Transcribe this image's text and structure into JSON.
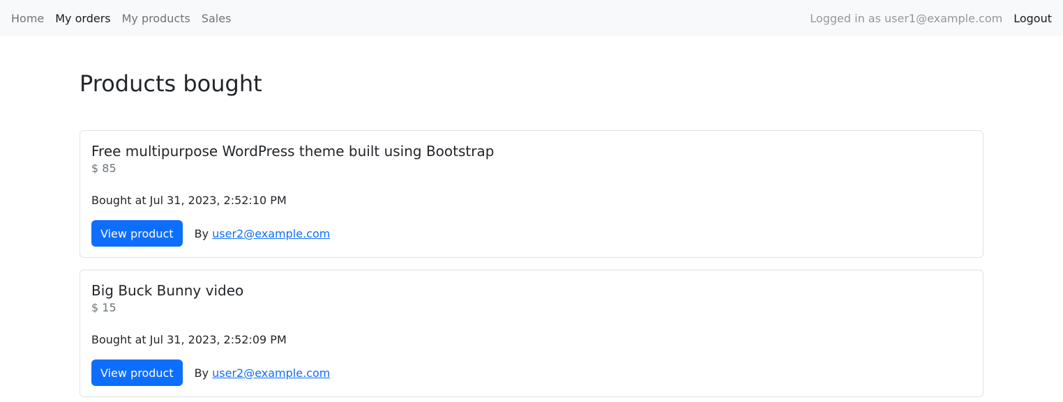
{
  "nav": {
    "items": [
      {
        "label": "Home",
        "active": false
      },
      {
        "label": "My orders",
        "active": true
      },
      {
        "label": "My products",
        "active": false
      },
      {
        "label": "Sales",
        "active": false
      }
    ],
    "logged_in_text": "Logged in as user1@example.com",
    "logout_label": "Logout"
  },
  "main": {
    "title": "Products bought",
    "orders": [
      {
        "title": "Free multipurpose WordPress theme built using Bootstrap",
        "price": "$ 85",
        "bought_at": "Bought at Jul 31, 2023, 2:52:10 PM",
        "view_label": "View product",
        "by_prefix": "By",
        "seller": "user2@example.com"
      },
      {
        "title": "Big Buck Bunny video",
        "price": "$ 15",
        "bought_at": "Bought at Jul 31, 2023, 2:52:09 PM",
        "view_label": "View product",
        "by_prefix": "By",
        "seller": "user2@example.com"
      }
    ]
  },
  "colors": {
    "primary": "#0d6efd",
    "navbar_bg": "#f8f9fa",
    "border": "#dee2e6"
  }
}
